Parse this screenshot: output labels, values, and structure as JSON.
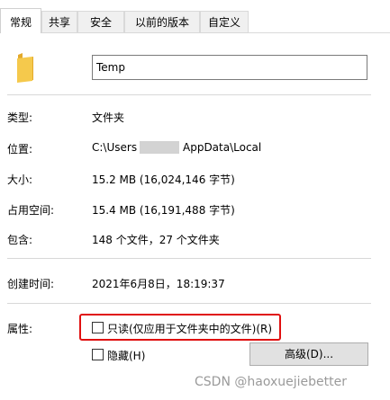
{
  "tabs": [
    {
      "label": "常规",
      "active": true
    },
    {
      "label": "共享"
    },
    {
      "label": "安全"
    },
    {
      "label": "以前的版本"
    },
    {
      "label": "自定义"
    }
  ],
  "name": {
    "value": "Temp"
  },
  "fields": {
    "type": {
      "label": "类型:",
      "value": "文件夹"
    },
    "location": {
      "label": "位置:",
      "value_start": "C:\\Users",
      "value_end": "AppData\\Local"
    },
    "size": {
      "label": "大小:",
      "value": "15.2 MB (16,024,146 字节)"
    },
    "size_on_disk": {
      "label": "占用空间:",
      "value": "15.4 MB (16,191,488 字节)"
    },
    "contains": {
      "label": "包含:",
      "value": "148 个文件，27 个文件夹"
    },
    "created": {
      "label": "创建时间:",
      "value": "2021年6月8日，18:19:37"
    }
  },
  "attributes": {
    "label": "属性:",
    "readonly_label": "只读(仅应用于文件夹中的文件)(R)",
    "hidden_label": "隐藏(H)",
    "advanced_button": "高级(D)..."
  },
  "watermark": "CSDN @haoxuejiebetter",
  "colors": {
    "highlight": "#e01010",
    "folder": "#f5c94c"
  }
}
